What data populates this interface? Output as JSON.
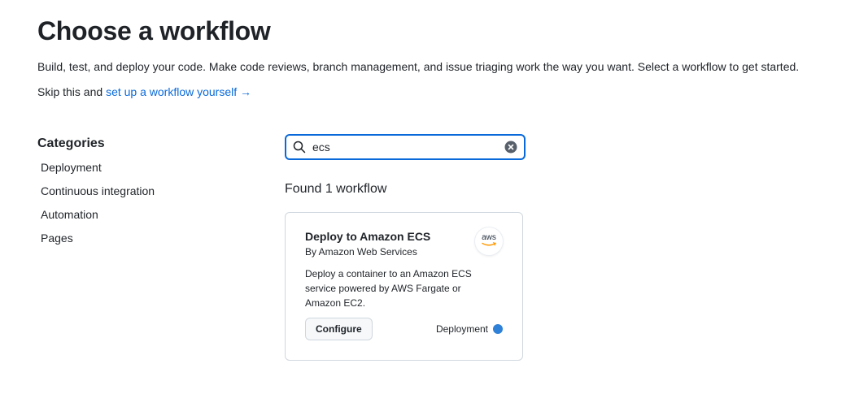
{
  "header": {
    "title": "Choose a workflow",
    "subtitle": "Build, test, and deploy your code. Make code reviews, branch management, and issue triaging work the way you want. Select a workflow to get started.",
    "skip_prefix": "Skip this and ",
    "skip_link": "set up a workflow yourself",
    "skip_arrow": "→"
  },
  "categories": {
    "heading": "Categories",
    "items": [
      {
        "label": "Deployment"
      },
      {
        "label": "Continuous integration"
      },
      {
        "label": "Automation"
      },
      {
        "label": "Pages"
      }
    ]
  },
  "search": {
    "value": "ecs",
    "search_icon": "search-icon",
    "clear_icon": "clear-icon"
  },
  "results": {
    "found_text": "Found 1 workflow",
    "cards": [
      {
        "title": "Deploy to Amazon ECS",
        "author": "By Amazon Web Services",
        "description": "Deploy a container to an Amazon ECS service powered by AWS Fargate or Amazon EC2.",
        "logo_text": "aws",
        "configure_label": "Configure",
        "category": "Deployment",
        "category_color": "#2f81d7"
      }
    ]
  },
  "colors": {
    "link": "#0969da",
    "focus_border": "#0969da",
    "aws_smile": "#ff9900"
  }
}
